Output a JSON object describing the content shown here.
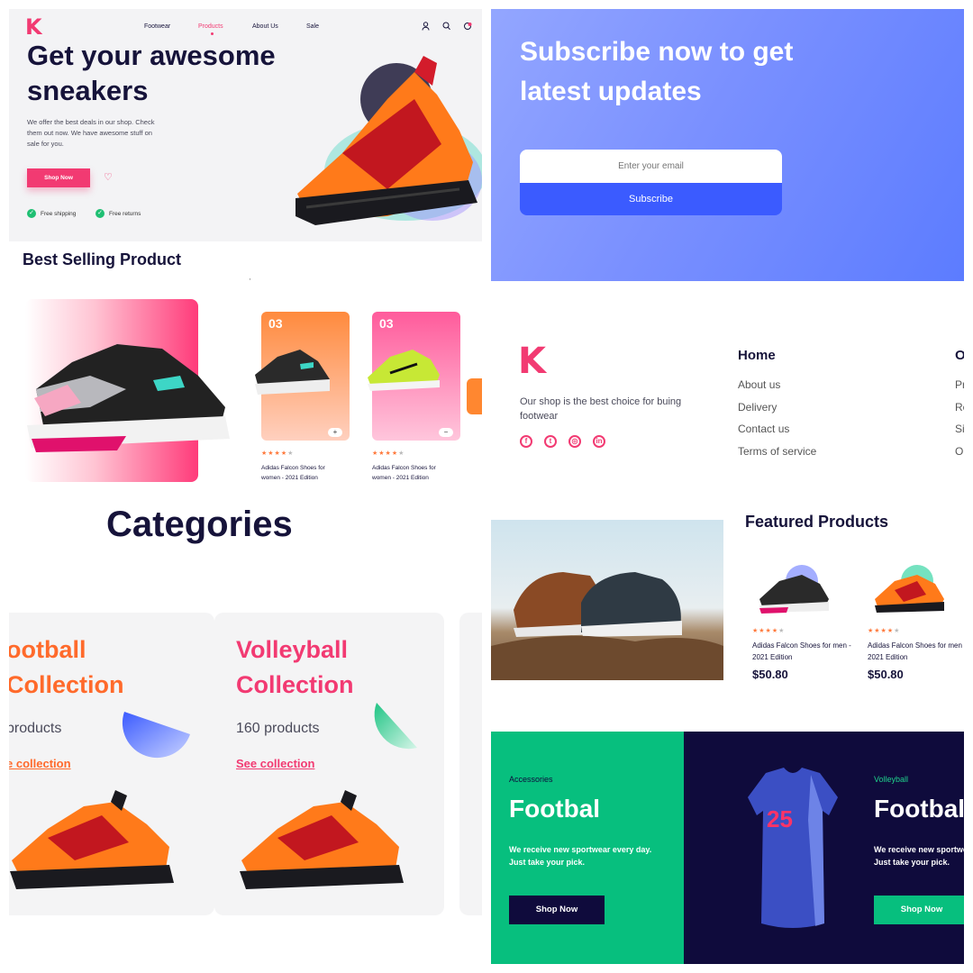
{
  "hero": {
    "logo": "K",
    "nav": [
      "Footwear",
      "Products",
      "About Us",
      "Sale"
    ],
    "active_nav": "Products",
    "icons": [
      "user-icon",
      "search-icon",
      "cart-icon"
    ],
    "headline": "Get your awesome sneakers",
    "description": "We offer the best deals in our shop. Check them out now. We have awesome stuff on sale for you.",
    "shop_button": "Shop Now",
    "features": [
      "Free shipping",
      "Free returns"
    ],
    "accent": "#f23a72"
  },
  "subscribe": {
    "headline": "Subscribe now to get latest updates",
    "email_placeholder": "Enter your email",
    "button": "Subscribe"
  },
  "best_selling": {
    "title": "Best Selling Product",
    "cards": [
      {
        "number": "03",
        "rating": 4,
        "name": "Adidas Falcon Shoes for women - 2021 Edition",
        "action": "+"
      },
      {
        "number": "03",
        "rating": 4,
        "name": "Adidas Falcon Shoes for women - 2021 Edition",
        "action": "−"
      }
    ]
  },
  "footer": {
    "logo": "K",
    "about": "Our shop is the best choice for buing footwear",
    "socials": [
      "facebook-icon",
      "twitter-icon",
      "instagram-icon",
      "linkedin-icon"
    ],
    "column_title": "Home",
    "column_title_2": "O",
    "links": [
      "About us",
      "Delivery",
      "Contact us",
      "Terms of service"
    ],
    "links_2": [
      "Pr",
      "Re",
      "Si",
      "O"
    ]
  },
  "categories": {
    "title": "Categories",
    "cards": [
      {
        "title": "ootball Collection",
        "count": " products",
        "link": "e collection",
        "color": "#ff6a2b"
      },
      {
        "title": "Volleyball Collection",
        "count": "160 products",
        "link": "See collection",
        "color": "#f23a72"
      }
    ]
  },
  "featured": {
    "title": "Featured Products",
    "products": [
      {
        "rating": 4,
        "name": "Adidas Falcon Shoes for men - 2021 Edition",
        "price": "$50.80"
      },
      {
        "rating": 4,
        "name": "Adidas Falcon Shoes for men - 2021 Edition",
        "price": "$50.80"
      }
    ]
  },
  "promo": {
    "green": {
      "tag": "Accessories",
      "title": "Footbal",
      "text": "We receive new sportwear every day. Just take your pick.",
      "button": "Shop Now"
    },
    "dark": {
      "tag": "Volleyball",
      "title": "Footbal",
      "text": "We receive new sportwear every day. Just take your pick.",
      "button": "Shop Now"
    }
  }
}
